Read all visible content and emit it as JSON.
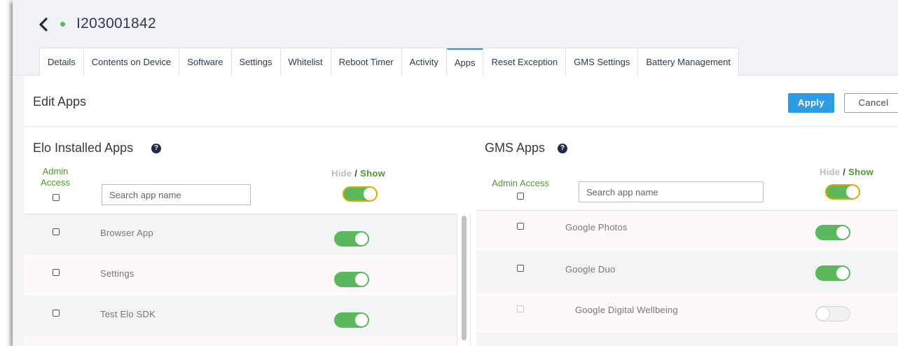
{
  "device": {
    "id": "I203001842",
    "status_color": "#5cb85c"
  },
  "tabs": [
    {
      "label": "Details"
    },
    {
      "label": "Contents on Device"
    },
    {
      "label": "Software"
    },
    {
      "label": "Settings"
    },
    {
      "label": "Whitelist"
    },
    {
      "label": "Reboot Timer"
    },
    {
      "label": "Activity"
    },
    {
      "label": "Apps",
      "active": true
    },
    {
      "label": "Reset Exception"
    },
    {
      "label": "GMS Settings"
    },
    {
      "label": "Battery Management"
    }
  ],
  "page": {
    "title": "Edit Apps",
    "apply_label": "Apply",
    "cancel_label": "Cancel",
    "accent_color": "#2e9be6"
  },
  "elo": {
    "title": "Elo Installed Apps",
    "admin_label_line1": "Admin",
    "admin_label_line2": "Access",
    "search_placeholder": "Search app name",
    "hide_label": "Hide",
    "slash": " / ",
    "show_label": "Show",
    "apps": [
      {
        "name": "Browser App",
        "admin": false,
        "shown": true
      },
      {
        "name": "Settings",
        "admin": false,
        "shown": true
      },
      {
        "name": "Test Elo SDK",
        "admin": false,
        "shown": true
      }
    ]
  },
  "gms": {
    "title": "GMS Apps",
    "admin_label": "Admin Access",
    "search_placeholder": "Search app name",
    "hide_label": "Hide",
    "slash": " / ",
    "show_label": "Show",
    "apps": [
      {
        "name": "Google Photos",
        "admin": false,
        "shown": true
      },
      {
        "name": "Google Duo",
        "admin": false,
        "shown": true
      },
      {
        "name": "Google Digital Wellbeing",
        "admin": false,
        "shown": false,
        "disabled": true
      }
    ]
  },
  "icons": {
    "back": "chevron-left-icon",
    "help": "question-circle-icon",
    "help_glyph": "?"
  }
}
